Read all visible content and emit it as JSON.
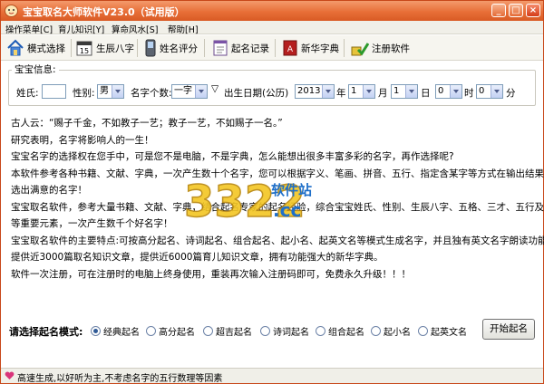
{
  "window": {
    "title": "宝宝取名大师软件V23.0（试用版）",
    "buttons": [
      "_",
      "□",
      "×"
    ]
  },
  "menu": [
    "操作菜单[C]",
    "育儿知识[Y]",
    "算命风水[S]",
    "帮助[H]"
  ],
  "toolbar": [
    {
      "label": "模式选择",
      "icon": "house-icon"
    },
    {
      "label": "生辰八字",
      "icon": "calendar-icon"
    },
    {
      "label": "姓名评分",
      "icon": "phone-icon"
    },
    {
      "label": "起名记录",
      "icon": "notepad-icon"
    },
    {
      "label": "新华字典",
      "icon": "dictionary-icon"
    },
    {
      "label": "注册软件",
      "icon": "register-icon"
    }
  ],
  "info": {
    "legend": "宝宝信息:",
    "surname_label": "姓氏:",
    "surname_value": "",
    "gender_label": "性别:",
    "gender_value": "男",
    "count_label": "名字个数:",
    "count_value": "一字",
    "birth_label": "出生日期(公历)",
    "year_value": "2013",
    "year_unit": "年",
    "month_value": "1",
    "month_unit": "月",
    "day_value": "1",
    "day_unit": "日",
    "hour_value": "0",
    "hour_unit": "时",
    "minute_value": "0",
    "minute_unit": "分"
  },
  "body_lines": [
    "古人云：“赐子千金，不如教子一艺；教子一艺，不如赐子一名。”",
    "研究表明，名字将影响人的一生！",
    "宝宝名字的选择权在您手中，可是您不是电脑，不是字典，怎么能想出很多丰富多彩的名字，再作选择呢?",
    "本软件参考各种书籍、文献、字典，一次产生数十个名字，您可以根据字义、笔画、拼音、五行、指定含某字等方式在输出结果里筛",
    "选出满意的名字！",
    "宝宝取名软件，参考大量书籍、文献、字典，结合起名专家的起名经验，综合宝宝姓氏、性别、生辰八字、五格、三才、五行及音律",
    "等重要元素，一次产生数千个好名字！",
    "宝宝取名软件的主要特点:可按高分起名、诗词起名、组合起名、起小名、起英文名等模式生成名字，并且独有英文名字朗读功能。",
    "提供近3000篇取名知识文章，提供近6000篇育儿知识文章，拥有功能强大的新华字典。",
    "软件一次注册，可在注册时的电脑上终身使用，重装再次输入注册码即可，免费永久升级！！！"
  ],
  "watermark": {
    "brand": "3322",
    "sub": "软件站",
    "tld": ".cc"
  },
  "mode": {
    "label": "请选择起名模式:",
    "options": [
      "经典起名",
      "高分起名",
      "超吉起名",
      "诗词起名",
      "组合起名",
      "起小名",
      "起英文名"
    ],
    "selected": "经典起名",
    "start_button": "开始起名"
  },
  "status": "高速生成,以好听为主,不考虑名字的五行数理等因素",
  "colors": {
    "titlebar": "#e86f38",
    "accent": "#2f5a96"
  }
}
